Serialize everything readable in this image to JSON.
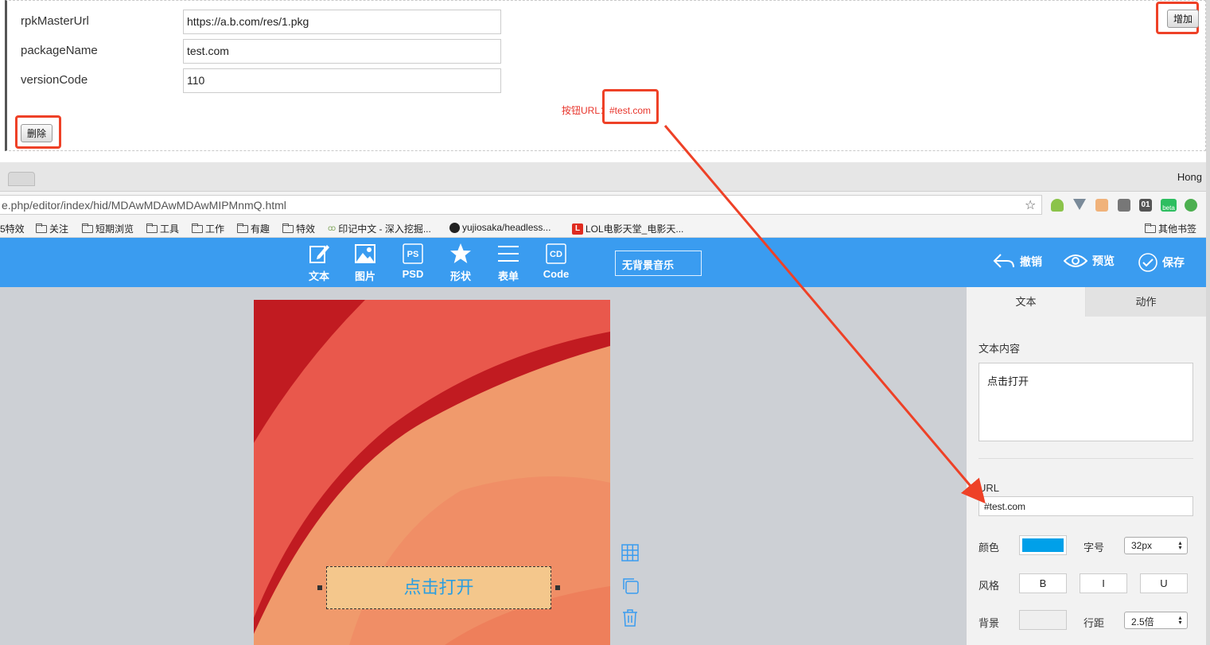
{
  "form": {
    "fields": [
      {
        "label": "rpkMasterUrl",
        "value": "https://a.b.com/res/1.pkg"
      },
      {
        "label": "packageName",
        "value": "test.com"
      },
      {
        "label": "versionCode",
        "value": "110"
      }
    ],
    "add_button": "增加",
    "delete_button": "删除",
    "button_url_note": "按钮URL：#test.com"
  },
  "browser": {
    "profile": "Hong",
    "address": "e.php/editor/index/hid/MDAwMDAwMDAwMIPMnmQ.html",
    "bookmarks": [
      {
        "label": "5特效",
        "icon": "none"
      },
      {
        "label": "关注",
        "icon": "folder-icon"
      },
      {
        "label": "短期浏览",
        "icon": "folder-icon"
      },
      {
        "label": "工具",
        "icon": "folder-icon"
      },
      {
        "label": "工作",
        "icon": "folder-icon"
      },
      {
        "label": "有趣",
        "icon": "folder-icon"
      },
      {
        "label": "特效",
        "icon": "folder-icon"
      },
      {
        "label": "印记中文 - 深入挖掘...",
        "icon": "yinji-icon"
      },
      {
        "label": "yujiosaka/headless...",
        "icon": "github-icon"
      },
      {
        "label": "LOL电影天堂_电影天...",
        "icon": "lol-icon"
      }
    ],
    "other_bookmarks": "其他书签",
    "extension_beta_badge": "beta",
    "extension_01_label": "01"
  },
  "toolbar": {
    "tools": [
      {
        "label": "文本",
        "icon": "edit-icon"
      },
      {
        "label": "图片",
        "icon": "image-icon"
      },
      {
        "label": "PSD",
        "icon": "psd-icon",
        "badge": "PS"
      },
      {
        "label": "形状",
        "icon": "star-icon"
      },
      {
        "label": "表单",
        "icon": "list-icon"
      },
      {
        "label": "Code",
        "icon": "code-icon",
        "badge": "CD"
      }
    ],
    "music": "无背景音乐",
    "actions": [
      {
        "label": "撤销",
        "icon": "undo-icon"
      },
      {
        "label": "预览",
        "icon": "eye-icon"
      },
      {
        "label": "保存",
        "icon": "check-circle-icon"
      }
    ],
    "color": "#3a9cf0"
  },
  "canvas": {
    "button_text": "点击打开"
  },
  "props": {
    "tabs": [
      "文本",
      "动作"
    ],
    "active_tab": "文本",
    "text_content_label": "文本内容",
    "text_content_value": "点击打开",
    "url_label": "URL",
    "url_value": "#test.com",
    "color_label": "颜色",
    "color_value": "#00a0e9",
    "font_size_label": "字号",
    "font_size_value": "32px",
    "style_label": "风格",
    "style_buttons": [
      "B",
      "I",
      "U"
    ],
    "bg_label": "背景",
    "line_height_label": "行距",
    "line_height_value": "2.5倍"
  }
}
